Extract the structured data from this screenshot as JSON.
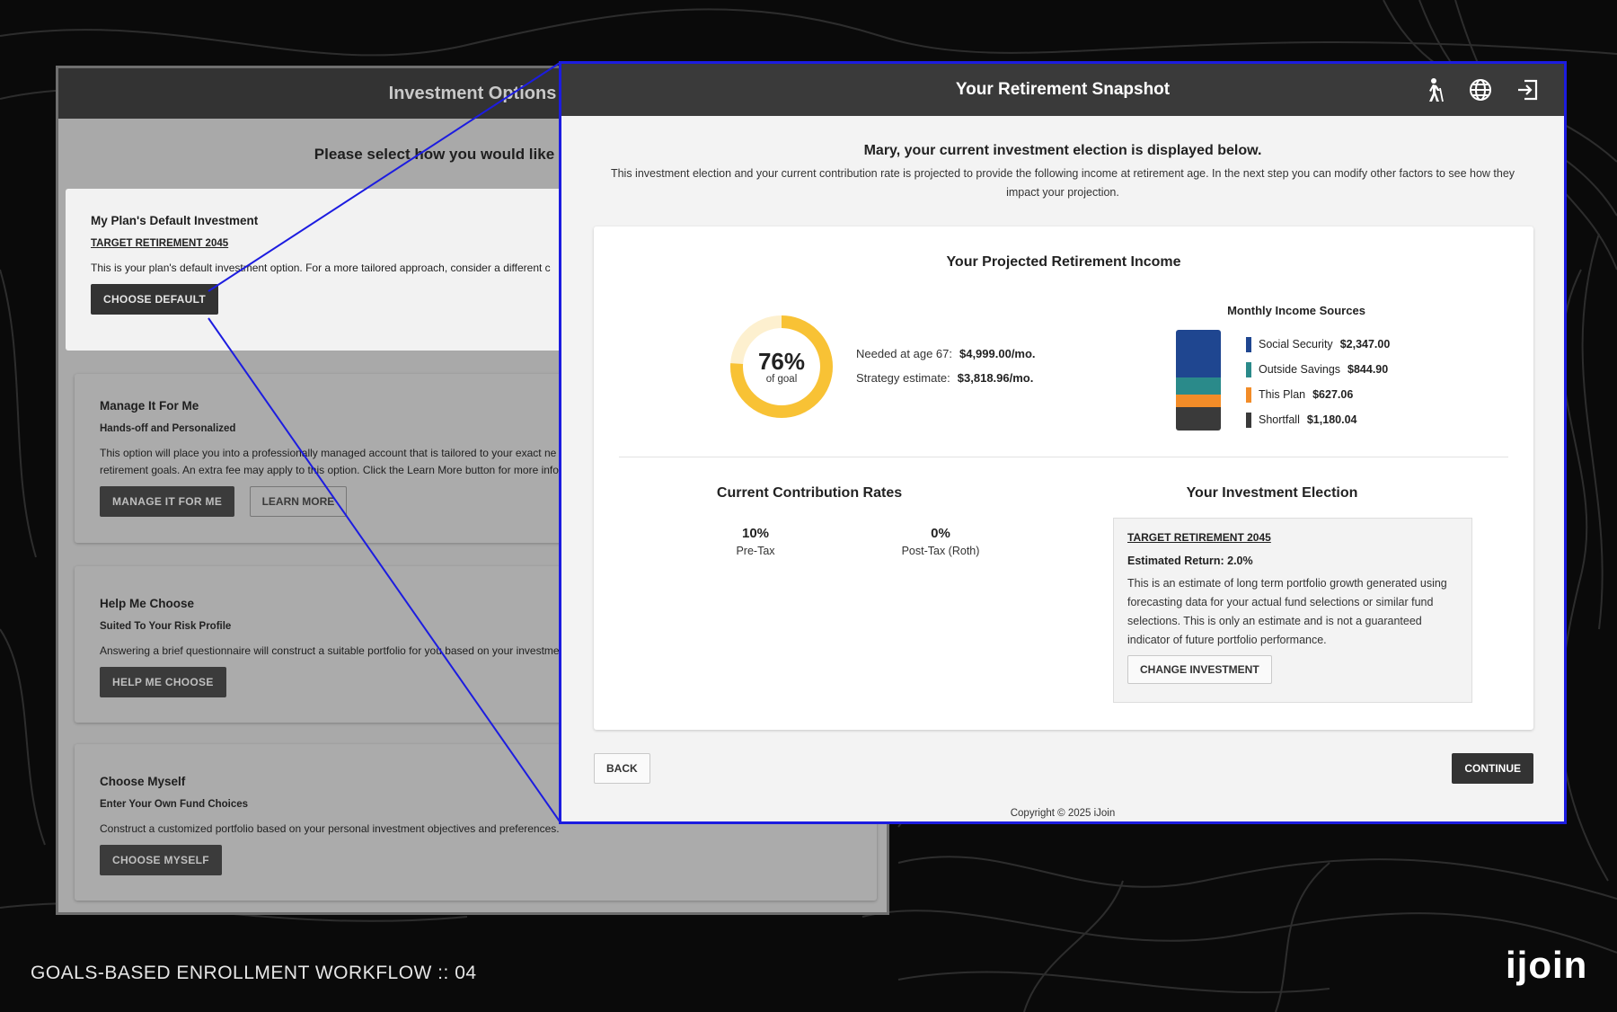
{
  "back_window": {
    "title": "Investment Options",
    "prompt": "Please select how you would like to choose",
    "cards": [
      {
        "title": "My Plan's Default Investment",
        "subtitle": "TARGET RETIREMENT 2045",
        "description": "This is your plan's default investment option. For a more tailored approach, consider a different c",
        "buttons": [
          "CHOOSE DEFAULT"
        ]
      },
      {
        "title": "Manage It For Me",
        "subtitle": "Hands-off and Personalized",
        "description_line1": "This option will place you into a professionally managed account that is tailored to your exact ne",
        "description_line2": "retirement goals. An extra fee may apply to this option. Click the Learn More button for more info",
        "buttons": [
          "MANAGE IT FOR ME",
          "LEARN MORE"
        ]
      },
      {
        "title": "Help Me Choose",
        "subtitle": "Suited To Your Risk Profile",
        "description": "Answering a brief questionnaire will construct a suitable portfolio for you based on your investme",
        "buttons": [
          "HELP ME CHOOSE"
        ]
      },
      {
        "title": "Choose Myself",
        "subtitle": "Enter Your Own Fund Choices",
        "description": "Construct a customized portfolio based on your personal investment objectives and preferences.",
        "buttons": [
          "CHOOSE MYSELF"
        ]
      }
    ]
  },
  "front_window": {
    "title": "Your Retirement Snapshot",
    "header_icons": [
      "person-walking-icon",
      "globe-icon",
      "sign-out-icon"
    ],
    "intro_title": "Mary, your current investment election is displayed below.",
    "intro_text": "This investment election and your current contribution rate is projected to provide the following income at retirement age. In the next step you can modify other factors to see how they impact your projection.",
    "projected": {
      "title": "Your Projected Retirement Income",
      "percent": 76,
      "percent_label": "76%",
      "goal_label": "of goal",
      "needed_label": "Needed at age 67:",
      "needed_value": "$4,999.00/mo.",
      "strategy_label": "Strategy estimate:",
      "strategy_value": "$3,818.96/mo."
    },
    "income_sources": {
      "title": "Monthly Income Sources",
      "items": [
        {
          "name": "Social Security",
          "amount": "$2,347.00",
          "value": 2347.0,
          "color": "#1f4690"
        },
        {
          "name": "Outside Savings",
          "amount": "$844.90",
          "value": 844.9,
          "color": "#2a8a8a"
        },
        {
          "name": "This Plan",
          "amount": "$627.06",
          "value": 627.06,
          "color": "#f28c28"
        },
        {
          "name": "Shortfall",
          "amount": "$1,180.04",
          "value": 1180.04,
          "color": "#3a3a3a"
        }
      ]
    },
    "contribution": {
      "title": "Current Contribution Rates",
      "rates": [
        {
          "value": "10%",
          "label": "Pre-Tax"
        },
        {
          "value": "0%",
          "label": "Post-Tax (Roth)"
        }
      ]
    },
    "election": {
      "title": "Your Investment Election",
      "fund": "TARGET RETIREMENT 2045",
      "estimated_return": "Estimated Return: 2.0%",
      "description": "This is an estimate of long term portfolio growth generated using forecasting data for your actual fund selections or similar fund selections. This is only an estimate and is not a guaranteed indicator of future portfolio performance.",
      "button": "CHANGE INVESTMENT"
    },
    "back_label": "BACK",
    "continue_label": "CONTINUE",
    "copyright": "Copyright © 2025 iJoin"
  },
  "footer": {
    "workflow_label": "GOALS-BASED ENROLLMENT WORKFLOW  ::  04",
    "brand": "ijoin"
  },
  "colors": {
    "donut_fill": "#f8c235",
    "donut_track": "#fdf0cf",
    "highlight_border": "#1c1ce0"
  }
}
